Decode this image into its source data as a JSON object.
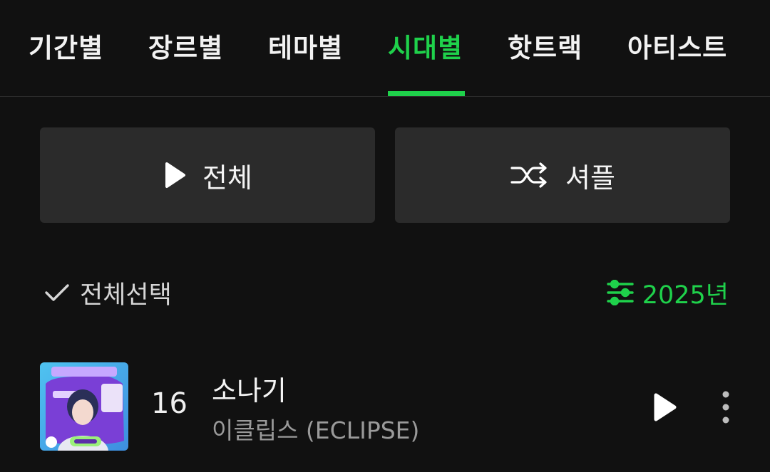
{
  "tabs": [
    {
      "label": "기간별",
      "active": false
    },
    {
      "label": "장르별",
      "active": false
    },
    {
      "label": "테마별",
      "active": false
    },
    {
      "label": "시대별",
      "active": true
    },
    {
      "label": "핫트랙",
      "active": false
    },
    {
      "label": "아티스트",
      "active": false
    }
  ],
  "actions": {
    "play_all_label": "전체",
    "shuffle_label": "셔플"
  },
  "list_controls": {
    "select_all_label": "전체선택",
    "year_filter_label": "2025년"
  },
  "tracks": [
    {
      "rank": "16",
      "title": "소나기",
      "artist": "이클립스 (ECLIPSE)"
    }
  ],
  "colors": {
    "accent": "#1fd14b",
    "background": "#111111",
    "button_bg": "#2b2b2b"
  },
  "icons": {
    "play": "play-icon",
    "shuffle": "shuffle-icon",
    "check": "check-icon",
    "filter": "sliders-icon",
    "more": "more-vertical-icon"
  }
}
